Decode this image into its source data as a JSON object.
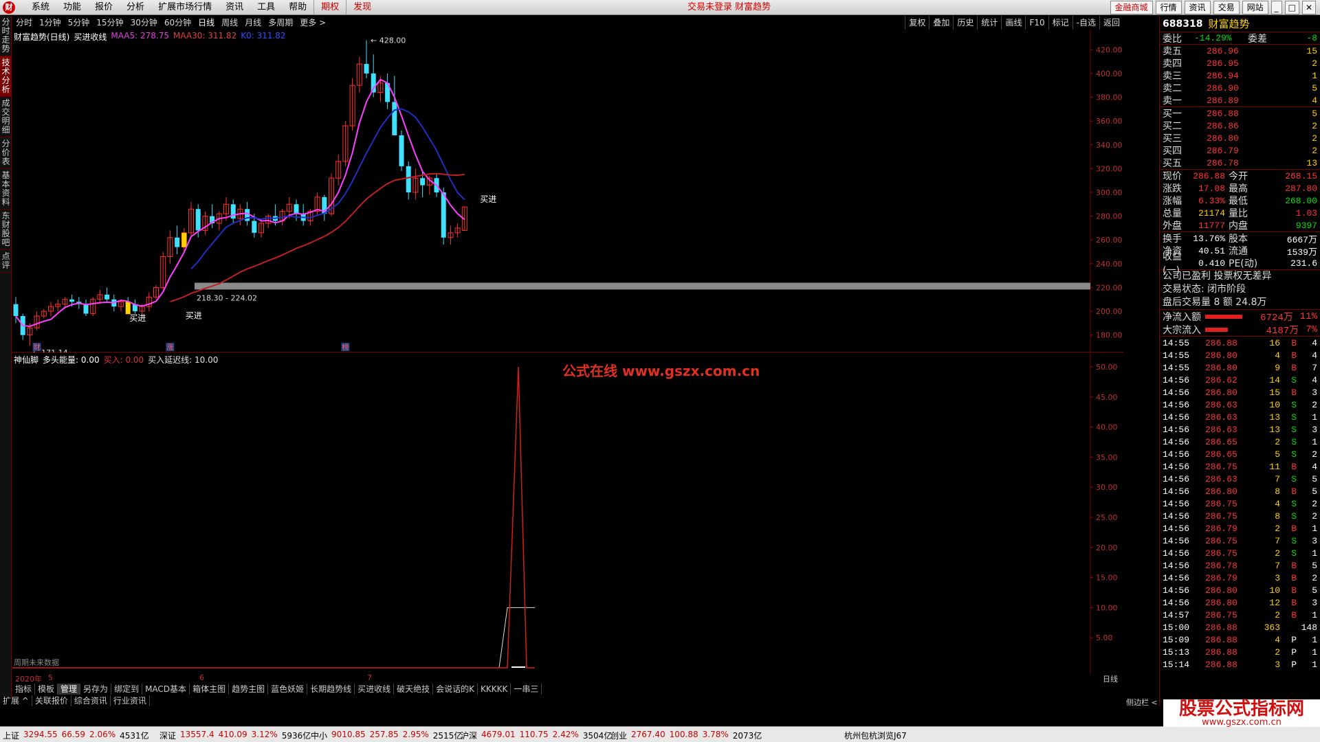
{
  "menubar": {
    "items": [
      "系统",
      "功能",
      "报价",
      "分析",
      "扩展市场行情",
      "资讯",
      "工具",
      "帮助",
      "期权",
      "发现"
    ],
    "status": "交易未登录 财富趋势",
    "right_buttons": [
      "金融商城",
      "行情",
      "资讯",
      "交易",
      "网站"
    ]
  },
  "left_tabs": [
    "分时走势",
    "技术分析",
    "成交明细",
    "分价表",
    "基本资料",
    "东财股吧",
    "点评"
  ],
  "period_bar": {
    "items": [
      "分时",
      "1分钟",
      "5分钟",
      "15分钟",
      "30分钟",
      "60分钟",
      "日线",
      "周线",
      "月线",
      "多周期",
      "更多 >"
    ],
    "active": "日线",
    "tools": [
      "复权",
      "叠加",
      "历史",
      "统计",
      "画线",
      "F10",
      "标记",
      "-自选",
      "返回"
    ]
  },
  "main_chart": {
    "title": "财富趋势(日线)",
    "indicator": "买进收线",
    "ma5_label": "MAA5: 278.75",
    "ma30_label": "MAA30: 311.82",
    "k_label": "K0: 311.82",
    "high_label": "428.00",
    "low_label": "171.14",
    "range_label": "218.30 - 224.02",
    "buy_label": "买进",
    "markers": [
      "财",
      "涨",
      "榜"
    ]
  },
  "sub_chart": {
    "title": "神仙脚",
    "items": [
      "多头能量: 0.00",
      "买入: 0.00",
      "买入延迟线: 10.00"
    ],
    "watermark": "公式在线 www.gszx.com.cn",
    "note": "周期未来数据"
  },
  "x_axis": {
    "labels": [
      "2020年",
      "5",
      "6",
      "7"
    ],
    "right": "日线"
  },
  "bottom_tabs": [
    "指标",
    "模板",
    "管理",
    "另存为",
    "绑定到",
    "MACD基本",
    "箱体主图",
    "趋势主图",
    "蓝色妖姬",
    "长期趋势线",
    "买进收线",
    "破天绝技",
    "会说话的K",
    "KKKKK",
    "一串三"
  ],
  "expand_row": [
    "扩展 ^",
    "关联报价",
    "综合资讯",
    "行业资讯"
  ],
  "sidebar_label": "侧边栏 <",
  "right_panel": {
    "code": "688318",
    "name": "财富趋势",
    "weibi": {
      "label": "委比",
      "value": "-14.29%",
      "label2": "委差",
      "value2": "-8"
    },
    "sells": [
      {
        "label": "卖五",
        "price": "286.96",
        "vol": "15"
      },
      {
        "label": "卖四",
        "price": "286.95",
        "vol": "2"
      },
      {
        "label": "卖三",
        "price": "286.94",
        "vol": "1"
      },
      {
        "label": "卖二",
        "price": "286.90",
        "vol": "5"
      },
      {
        "label": "卖一",
        "price": "286.89",
        "vol": "4"
      }
    ],
    "buys": [
      {
        "label": "买一",
        "price": "286.88",
        "vol": "5"
      },
      {
        "label": "买二",
        "price": "286.86",
        "vol": "2"
      },
      {
        "label": "买三",
        "price": "286.80",
        "vol": "2"
      },
      {
        "label": "买四",
        "price": "286.79",
        "vol": "2"
      },
      {
        "label": "买五",
        "price": "286.78",
        "vol": "13"
      }
    ],
    "quote": [
      {
        "l1": "现价",
        "v1": "286.88",
        "c1": "red",
        "l2": "今开",
        "v2": "268.15",
        "c2": "red"
      },
      {
        "l1": "涨跌",
        "v1": "17.08",
        "c1": "red",
        "l2": "最高",
        "v2": "287.80",
        "c2": "red"
      },
      {
        "l1": "涨幅",
        "v1": "6.33%",
        "c1": "red",
        "l2": "最低",
        "v2": "268.00",
        "c2": "green"
      },
      {
        "l1": "总量",
        "v1": "21174",
        "c1": "yellow",
        "l2": "量比",
        "v2": "1.03",
        "c2": "red"
      },
      {
        "l1": "外盘",
        "v1": "11777",
        "c1": "red",
        "l2": "内盘",
        "v2": "9397",
        "c2": "green"
      }
    ],
    "stats": [
      {
        "l1": "换手",
        "v1": "13.76%",
        "l2": "股本",
        "v2": "6667万"
      },
      {
        "l1": "净资",
        "v1": "40.51",
        "l2": "流通",
        "v2": "1539万"
      },
      {
        "l1": "收益(一)",
        "v1": "0.410",
        "l2": "PE(动)",
        "v2": "231.6"
      }
    ],
    "notes": [
      "公司已盈利 投票权无差异",
      "交易状态: 闭市阶段",
      "盘后交易量 8 额 24.8万"
    ],
    "flows": [
      {
        "label": "净流入额",
        "value": "6724万",
        "pct": "11%",
        "fill": 0.9
      },
      {
        "label": "大宗流入",
        "value": "4187万",
        "pct": "7%",
        "fill": 0.55
      }
    ],
    "ticks": [
      {
        "t": "14:55",
        "p": "286.88",
        "v": "16",
        "d": "B",
        "n": "4"
      },
      {
        "t": "14:55",
        "p": "286.80",
        "v": "4",
        "d": "B",
        "n": "4"
      },
      {
        "t": "14:55",
        "p": "286.80",
        "v": "9",
        "d": "B",
        "n": "7"
      },
      {
        "t": "14:56",
        "p": "286.62",
        "v": "14",
        "d": "S",
        "n": "4"
      },
      {
        "t": "14:56",
        "p": "286.80",
        "v": "15",
        "d": "B",
        "n": "3"
      },
      {
        "t": "14:56",
        "p": "286.63",
        "v": "10",
        "d": "S",
        "n": "2"
      },
      {
        "t": "14:56",
        "p": "286.63",
        "v": "13",
        "d": "S",
        "n": "1"
      },
      {
        "t": "14:56",
        "p": "286.63",
        "v": "13",
        "d": "S",
        "n": "3"
      },
      {
        "t": "14:56",
        "p": "286.65",
        "v": "2",
        "d": "S",
        "n": "1"
      },
      {
        "t": "14:56",
        "p": "286.65",
        "v": "5",
        "d": "S",
        "n": "2"
      },
      {
        "t": "14:56",
        "p": "286.75",
        "v": "11",
        "d": "B",
        "n": "4"
      },
      {
        "t": "14:56",
        "p": "286.63",
        "v": "7",
        "d": "S",
        "n": "5"
      },
      {
        "t": "14:56",
        "p": "286.80",
        "v": "8",
        "d": "B",
        "n": "5"
      },
      {
        "t": "14:56",
        "p": "286.75",
        "v": "4",
        "d": "S",
        "n": "2"
      },
      {
        "t": "14:56",
        "p": "286.75",
        "v": "8",
        "d": "S",
        "n": "2"
      },
      {
        "t": "14:56",
        "p": "286.79",
        "v": "2",
        "d": "B",
        "n": "1"
      },
      {
        "t": "14:56",
        "p": "286.75",
        "v": "7",
        "d": "S",
        "n": "3"
      },
      {
        "t": "14:56",
        "p": "286.75",
        "v": "2",
        "d": "S",
        "n": "1"
      },
      {
        "t": "14:56",
        "p": "286.78",
        "v": "7",
        "d": "B",
        "n": "5"
      },
      {
        "t": "14:56",
        "p": "286.79",
        "v": "3",
        "d": "B",
        "n": "2"
      },
      {
        "t": "14:56",
        "p": "286.80",
        "v": "10",
        "d": "B",
        "n": "5"
      },
      {
        "t": "14:56",
        "p": "286.80",
        "v": "12",
        "d": "B",
        "n": "3"
      },
      {
        "t": "14:57",
        "p": "286.75",
        "v": "2",
        "d": "B",
        "n": "1"
      },
      {
        "t": "15:00",
        "p": "286.88",
        "v": "363",
        "d": "",
        "n": "148"
      },
      {
        "t": "15:09",
        "p": "286.88",
        "v": "4",
        "d": "P",
        "n": "1"
      },
      {
        "t": "15:13",
        "p": "286.88",
        "v": "2",
        "d": "P",
        "n": "1"
      },
      {
        "t": "15:14",
        "p": "286.88",
        "v": "3",
        "d": "P",
        "n": "1"
      }
    ]
  },
  "status_bar": {
    "indices": [
      {
        "name": "上证",
        "value": "3294.55",
        "chg": "66.59",
        "pct": "2.06%",
        "amt": "4531亿"
      },
      {
        "name": "深证",
        "value": "13557.4",
        "chg": "410.09",
        "pct": "3.12%",
        "amt": "5936亿"
      },
      {
        "name": "中小",
        "value": "9010.85",
        "chg": "257.85",
        "pct": "2.95%",
        "amt": "2515亿"
      },
      {
        "name": "沪深",
        "value": "4679.01",
        "chg": "110.75",
        "pct": "2.42%",
        "amt": "3504亿"
      },
      {
        "name": "创业",
        "value": "2767.40",
        "chg": "100.88",
        "pct": "3.78%",
        "amt": "2073亿"
      }
    ],
    "browser": "杭州包杭浏览J67"
  },
  "ad_banner": {
    "title": "股票公式指标网",
    "url": "www.gszx.com.cn"
  },
  "chart_data": [
    {
      "type": "candlestick",
      "title": "财富趋势(日线)",
      "ylim": [
        170,
        430
      ],
      "y_ticks": [
        "420.00",
        "400.00",
        "380.00",
        "360.00",
        "340.00",
        "320.00",
        "300.00",
        "280.00",
        "260.00",
        "240.00",
        "220.00",
        "200.00",
        "180.00"
      ],
      "candles": [
        [
          206,
          212,
          190,
          196
        ],
        [
          196,
          198,
          176,
          180
        ],
        [
          180,
          190,
          171.14,
          186
        ],
        [
          186,
          200,
          184,
          196
        ],
        [
          196,
          202,
          194,
          200
        ],
        [
          200,
          208,
          196,
          204
        ],
        [
          204,
          210,
          200,
          206
        ],
        [
          206,
          212,
          202,
          210
        ],
        [
          210,
          214,
          204,
          208
        ],
        [
          208,
          212,
          202,
          206
        ],
        [
          206,
          210,
          196,
          198
        ],
        [
          198,
          212,
          196,
          210
        ],
        [
          210,
          218,
          206,
          214
        ],
        [
          214,
          220,
          208,
          210
        ],
        [
          210,
          214,
          200,
          204
        ],
        [
          204,
          210,
          200,
          208
        ],
        [
          208,
          212,
          202,
          206
        ],
        [
          206,
          210,
          198,
          200
        ],
        [
          200,
          206,
          196,
          204
        ],
        [
          204,
          216,
          200,
          212
        ],
        [
          212,
          222,
          210,
          220
        ],
        [
          220,
          250,
          218,
          246
        ],
        [
          246,
          268,
          240,
          262
        ],
        [
          262,
          272,
          248,
          254
        ],
        [
          254,
          270,
          250,
          266
        ],
        [
          266,
          292,
          262,
          286
        ],
        [
          286,
          290,
          262,
          268
        ],
        [
          268,
          284,
          264,
          280
        ],
        [
          280,
          290,
          270,
          274
        ],
        [
          274,
          284,
          268,
          282
        ],
        [
          282,
          296,
          276,
          290
        ],
        [
          290,
          294,
          274,
          278
        ],
        [
          278,
          290,
          272,
          286
        ],
        [
          286,
          292,
          272,
          276
        ],
        [
          276,
          282,
          262,
          266
        ],
        [
          266,
          278,
          262,
          274
        ],
        [
          274,
          282,
          270,
          280
        ],
        [
          280,
          290,
          272,
          276
        ],
        [
          276,
          286,
          272,
          284
        ],
        [
          284,
          296,
          278,
          290
        ],
        [
          290,
          294,
          276,
          282
        ],
        [
          282,
          290,
          272,
          276
        ],
        [
          276,
          286,
          272,
          284
        ],
        [
          284,
          300,
          280,
          296
        ],
        [
          296,
          298,
          276,
          282
        ],
        [
          282,
          316,
          280,
          312
        ],
        [
          312,
          332,
          306,
          326
        ],
        [
          326,
          360,
          322,
          356
        ],
        [
          356,
          396,
          352,
          390
        ],
        [
          390,
          414,
          384,
          408
        ],
        [
          408,
          428,
          396,
          400
        ],
        [
          400,
          416,
          380,
          384
        ],
        [
          384,
          398,
          376,
          392
        ],
        [
          392,
          400,
          370,
          376
        ],
        [
          376,
          398,
          360,
          348
        ],
        [
          348,
          352,
          318,
          322
        ],
        [
          322,
          326,
          294,
          300
        ],
        [
          300,
          320,
          294,
          312
        ],
        [
          312,
          318,
          296,
          306
        ],
        [
          306,
          314,
          298,
          312
        ],
        [
          312,
          316,
          296,
          300
        ],
        [
          300,
          304,
          256,
          262
        ],
        [
          262,
          272,
          256,
          266
        ],
        [
          266,
          274,
          262,
          270
        ],
        [
          268,
          288,
          268,
          287.8
        ]
      ],
      "ma5_label": "MAA5: 278.75",
      "ma30_label": "MAA30: 311.82",
      "high": 428.0,
      "low": 171.14,
      "support_band": [
        218.3,
        224.02
      ]
    },
    {
      "type": "line",
      "title": "神仙脚",
      "ylim": [
        0,
        50
      ],
      "y_ticks": [
        "50.00",
        "45.00",
        "40.00",
        "35.00",
        "30.00",
        "25.00",
        "20.00",
        "15.00",
        "10.00",
        "5.00"
      ],
      "series": [
        {
          "name": "多头能量",
          "values": [
            0,
            0,
            0,
            50,
            0,
            0
          ]
        },
        {
          "name": "买入延迟线",
          "values": [
            0,
            0,
            10,
            10,
            10,
            10
          ]
        }
      ]
    }
  ]
}
